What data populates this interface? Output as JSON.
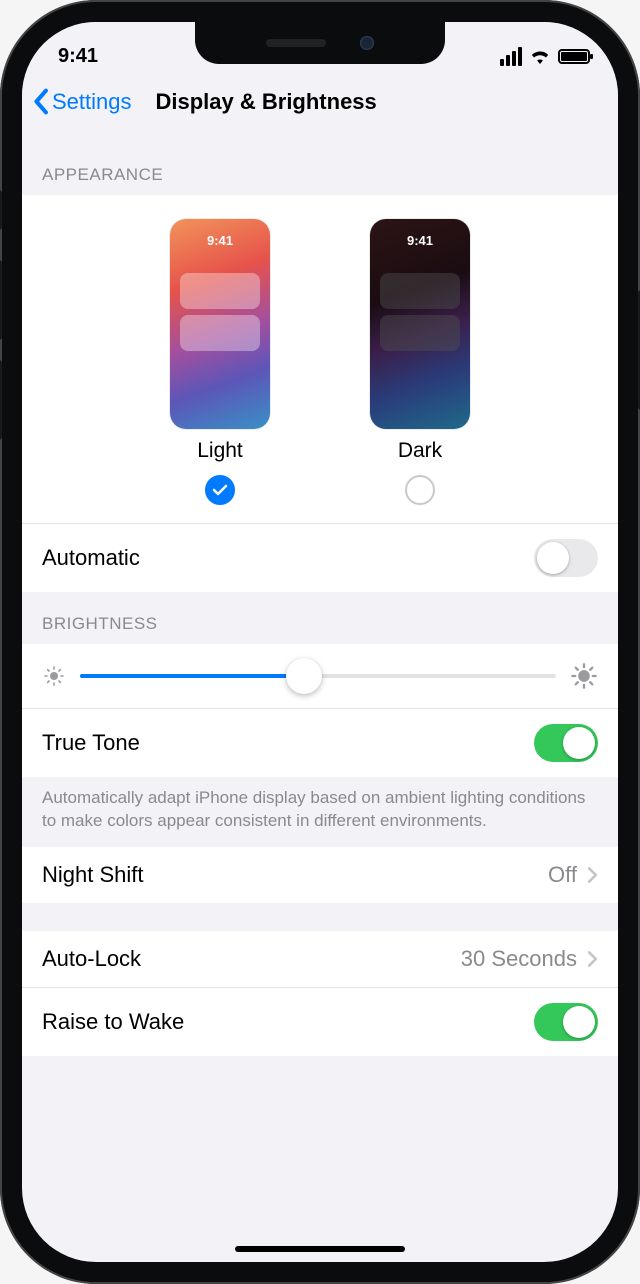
{
  "status": {
    "time": "9:41"
  },
  "nav": {
    "back": "Settings",
    "title": "Display & Brightness"
  },
  "appearance": {
    "header": "APPEARANCE",
    "preview_time": "9:41",
    "options": [
      {
        "label": "Light",
        "selected": true
      },
      {
        "label": "Dark",
        "selected": false
      }
    ],
    "automatic": {
      "label": "Automatic",
      "on": false
    }
  },
  "brightness": {
    "header": "BRIGHTNESS",
    "slider_percent": 47,
    "trueTone": {
      "label": "True Tone",
      "on": true
    },
    "footer": "Automatically adapt iPhone display based on ambient lighting conditions to make colors appear consistent in different environments."
  },
  "nightShift": {
    "label": "Night Shift",
    "value": "Off"
  },
  "autoLock": {
    "label": "Auto-Lock",
    "value": "30 Seconds"
  },
  "raiseToWake": {
    "label": "Raise to Wake",
    "on": true
  }
}
